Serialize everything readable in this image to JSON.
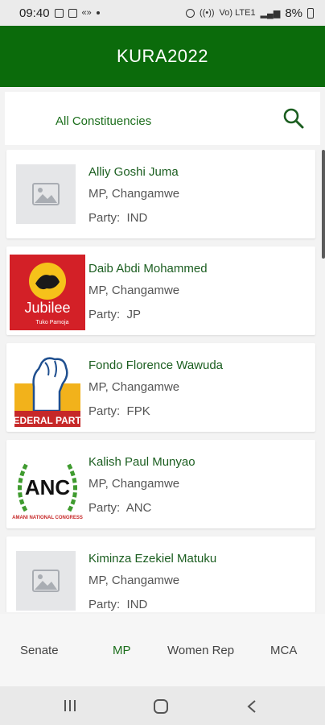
{
  "status_bar": {
    "time": "09:40",
    "battery": "8%",
    "net": "Vo) LTE1"
  },
  "app": {
    "title": "KURA2022"
  },
  "filter": {
    "label": "All Constituencies"
  },
  "candidates": [
    {
      "name": "Alliy Goshi Juma",
      "role": "MP, Changamwe",
      "party_label": "Party:",
      "party": "IND",
      "image": "placeholder-image-icon"
    },
    {
      "name": "Daib Abdi Mohammed",
      "role": "MP, Changamwe",
      "party_label": "Party:",
      "party": "JP",
      "image": "jubilee-logo",
      "logo_text": "Jubilee",
      "logo_subtext": "Tuko Pamoja"
    },
    {
      "name": "Fondo Florence Wawuda",
      "role": "MP, Changamwe",
      "party_label": "Party:",
      "party": "FPK",
      "image": "federal-party-logo",
      "logo_text": "FEDERAL PARTY"
    },
    {
      "name": "Kalish Paul Munyao",
      "role": "MP, Changamwe",
      "party_label": "Party:",
      "party": "ANC",
      "image": "anc-logo",
      "logo_text": "ANC",
      "logo_subtext": "AMANI NATIONAL CONGRESS"
    },
    {
      "name": "Kiminza Ezekiel Matuku",
      "role": "MP, Changamwe",
      "party_label": "Party:",
      "party": "IND",
      "image": "placeholder-image-icon"
    }
  ],
  "tabs": [
    {
      "label": "Senate",
      "active": false
    },
    {
      "label": "MP",
      "active": true
    },
    {
      "label": "Women Rep",
      "active": false
    },
    {
      "label": "MCA",
      "active": false
    }
  ],
  "colors": {
    "primary": "#0b6b0b",
    "accent_text": "#1b5e20",
    "jubilee_red": "#d32027",
    "jubilee_yellow": "#f6c21a",
    "fpk_red": "#c62828"
  }
}
